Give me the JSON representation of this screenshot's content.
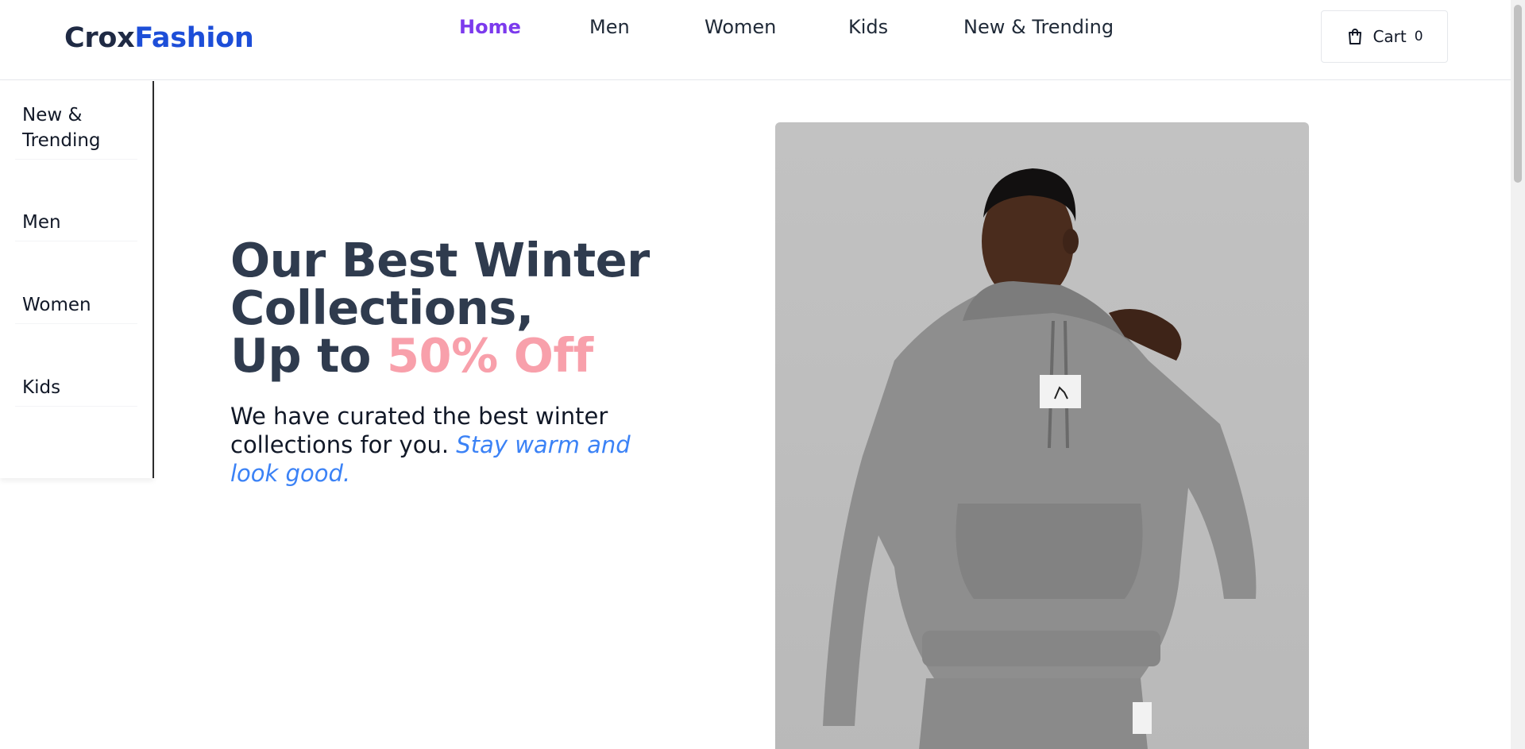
{
  "brand": {
    "part1": "Crox",
    "part2": "Fashion"
  },
  "nav": {
    "items": [
      {
        "label": "Home",
        "active": true
      },
      {
        "label": "Men",
        "active": false
      },
      {
        "label": "Women",
        "active": false
      },
      {
        "label": "Kids",
        "active": false
      },
      {
        "label": "New & Trending",
        "active": false
      }
    ]
  },
  "cart": {
    "label": "Cart",
    "count": "0",
    "icon": "shopping-bag-icon"
  },
  "sidebar": {
    "items": [
      {
        "label": "New & Trending"
      },
      {
        "label": "Men"
      },
      {
        "label": "Women"
      },
      {
        "label": "Kids"
      }
    ]
  },
  "hero": {
    "title_line1": "Our Best Winter",
    "title_line2": "Collections,",
    "title_line3_prefix": "Up to ",
    "title_highlight": "50% Off",
    "desc": "We have curated the best winter collections for you. ",
    "desc_em": "Stay warm and look good.",
    "image_alt": "Model wearing grey hoodie and joggers"
  },
  "colors": {
    "brand_dark": "#1f2a44",
    "brand_blue": "#1d4ed8",
    "nav_active": "#7c3aed",
    "highlight_pink": "#f8a0ab",
    "accent_blue": "#3b82f6"
  }
}
